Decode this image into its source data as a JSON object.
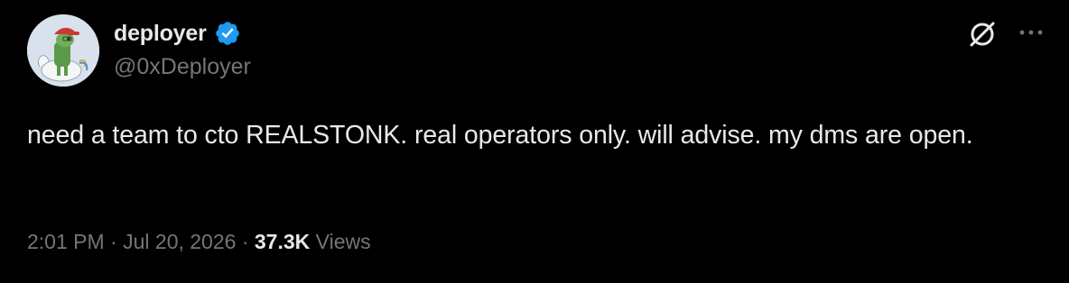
{
  "author": {
    "display_name": "deployer",
    "handle": "@0xDeployer",
    "verified": true,
    "avatar_icon": "avatar-cartoon-character-icon"
  },
  "actions": {
    "grok_icon": "grok-icon",
    "more_icon": "more-options-icon"
  },
  "tweet": {
    "text": "need a team to cto REALSTONK. real operators only. will advise. my dms are open."
  },
  "meta": {
    "time": "2:01 PM",
    "sep1": " · ",
    "date": "Jul 20, 2026",
    "sep2": " · ",
    "views_count": "37.3K",
    "views_label": " Views"
  },
  "colors": {
    "background": "#000000",
    "text": "#e7e9ea",
    "secondary": "#71767b",
    "verified": "#1d9bf0"
  }
}
